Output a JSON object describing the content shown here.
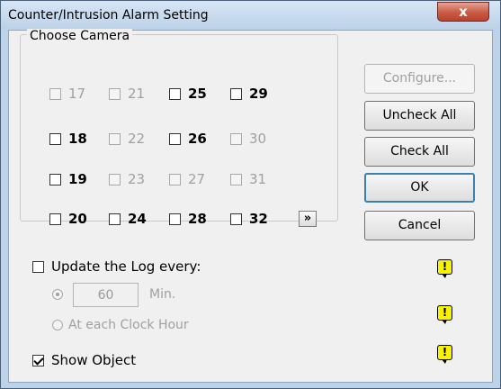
{
  "window": {
    "title": "Counter/Intrusion Alarm Setting",
    "close_glyph": "x"
  },
  "camera_group": {
    "label": "Choose Camera",
    "cameras": [
      {
        "label": "17",
        "enabled": false,
        "checked": false
      },
      {
        "label": "21",
        "enabled": false,
        "checked": false
      },
      {
        "label": "25",
        "enabled": true,
        "checked": false
      },
      {
        "label": "29",
        "enabled": true,
        "checked": false
      },
      {
        "label": "18",
        "enabled": true,
        "checked": false
      },
      {
        "label": "22",
        "enabled": false,
        "checked": false
      },
      {
        "label": "26",
        "enabled": true,
        "checked": false
      },
      {
        "label": "30",
        "enabled": false,
        "checked": false
      },
      {
        "label": "19",
        "enabled": true,
        "checked": false
      },
      {
        "label": "23",
        "enabled": false,
        "checked": false
      },
      {
        "label": "27",
        "enabled": false,
        "checked": false
      },
      {
        "label": "31",
        "enabled": false,
        "checked": false
      },
      {
        "label": "20",
        "enabled": true,
        "checked": false
      },
      {
        "label": "24",
        "enabled": true,
        "checked": false
      },
      {
        "label": "28",
        "enabled": true,
        "checked": false
      },
      {
        "label": "32",
        "enabled": true,
        "checked": false
      }
    ],
    "more_label": "»"
  },
  "buttons": {
    "configure": "Configure...",
    "uncheck_all": "Uncheck All",
    "check_all": "Check All",
    "ok": "OK",
    "cancel": "Cancel"
  },
  "log": {
    "update_label": "Update the Log every:",
    "update_checked": false,
    "minutes_value": "60",
    "minutes_unit": "Min.",
    "clock_hour_label": "At each Clock Hour"
  },
  "show_object": {
    "label": "Show Object",
    "checked": true
  },
  "icons": {
    "alarm": "warning-note-icon",
    "alarm_glyph": "!",
    "alarm_color": "#f8f200"
  }
}
